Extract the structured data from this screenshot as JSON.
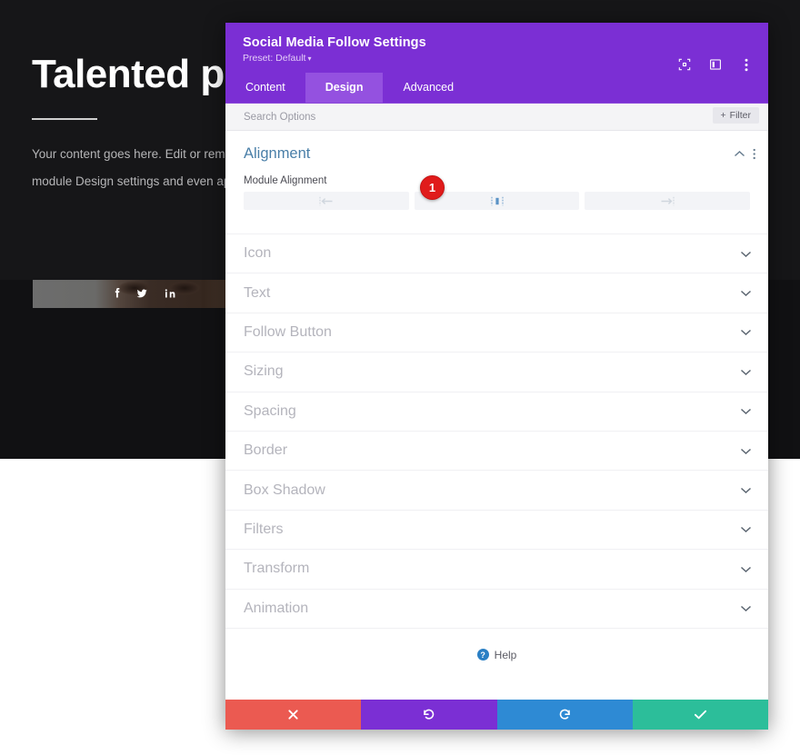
{
  "background_page": {
    "title": "Talented peo",
    "body_lines": "Your content goes here. Edit or remove\nmodule Design settings and even appl",
    "social_icons": [
      {
        "name": "facebook-icon",
        "label": "Facebook"
      },
      {
        "name": "twitter-icon",
        "label": "Twitter"
      },
      {
        "name": "linkedin-icon",
        "label": "LinkedIn"
      }
    ]
  },
  "modal": {
    "title": "Social Media Follow Settings",
    "preset_label": "Preset: Default",
    "preset_caret": "▾",
    "header_icons": [
      {
        "name": "responsive-view-icon",
        "label": "Responsive Views"
      },
      {
        "name": "panel-layout-icon",
        "label": "Change Modal Position"
      },
      {
        "name": "kebab-menu-icon",
        "label": "More Options"
      }
    ],
    "tabs": [
      {
        "label": "Content",
        "active": false
      },
      {
        "label": "Design",
        "active": true
      },
      {
        "label": "Advanced",
        "active": false
      }
    ],
    "search": {
      "placeholder": "Search Options",
      "value": ""
    },
    "filter_button": {
      "label": "Filter",
      "plus": "+"
    },
    "open_section": {
      "title": "Alignment",
      "collapse_icon": "chevron-up-icon",
      "menu_icon": "kebab-menu-icon",
      "field_label": "Module Alignment",
      "options": [
        {
          "name": "align-left",
          "label": "Left",
          "active": false
        },
        {
          "name": "align-center",
          "label": "Center",
          "active": true
        },
        {
          "name": "align-right",
          "label": "Right",
          "active": false
        }
      ],
      "badge": "1"
    },
    "collapsed_sections": [
      {
        "label": "Icon"
      },
      {
        "label": "Text"
      },
      {
        "label": "Follow Button"
      },
      {
        "label": "Sizing"
      },
      {
        "label": "Spacing"
      },
      {
        "label": "Border"
      },
      {
        "label": "Box Shadow"
      },
      {
        "label": "Filters"
      },
      {
        "label": "Transform"
      },
      {
        "label": "Animation"
      }
    ],
    "help": {
      "label": "Help",
      "icon_glyph": "?"
    },
    "footer_buttons": [
      {
        "name": "cancel-button",
        "icon": "close-icon",
        "color": "#eb5a51"
      },
      {
        "name": "undo-button",
        "icon": "undo-icon",
        "color": "#7b2fd4"
      },
      {
        "name": "redo-button",
        "icon": "redo-icon",
        "color": "#2e8ad4"
      },
      {
        "name": "save-button",
        "icon": "check-icon",
        "color": "#2cbe9a"
      }
    ]
  },
  "colors": {
    "accent_purple": "#7b2fd4",
    "tab_active": "#9451e0",
    "section_title": "#4a7fa8",
    "badge_red": "#e01b1b",
    "save_green": "#2cbe9a",
    "redo_blue": "#2e8ad4",
    "cancel_red": "#eb5a51"
  }
}
